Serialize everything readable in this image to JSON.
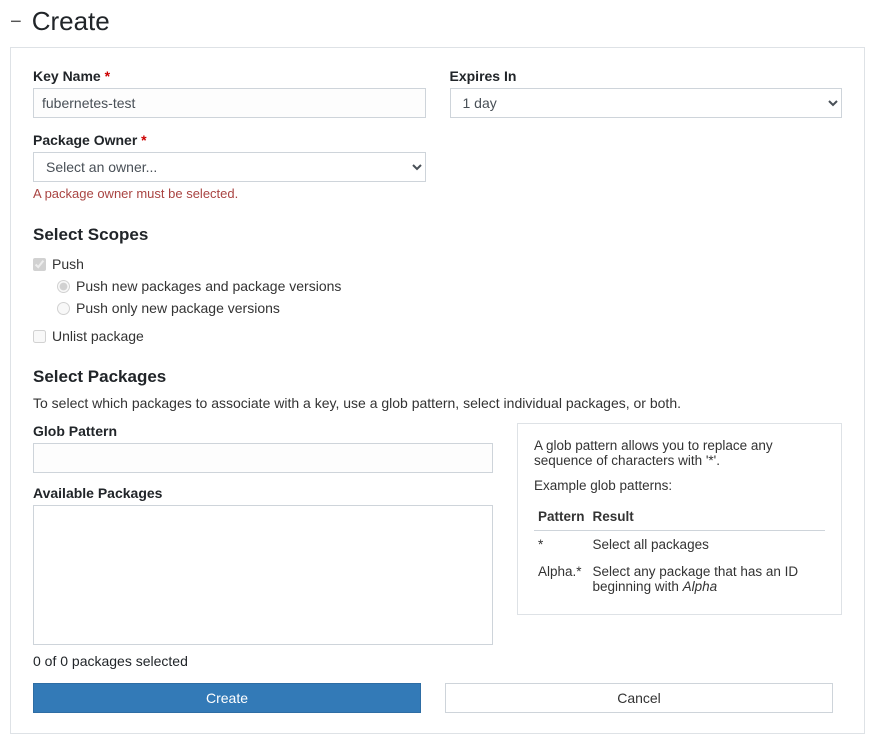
{
  "header": {
    "title": "Create"
  },
  "fields": {
    "key_name": {
      "label": "Key Name",
      "required_mark": "*",
      "value": "fubernetes-test"
    },
    "expires": {
      "label": "Expires In",
      "value": "1 day"
    },
    "owner": {
      "label": "Package Owner",
      "required_mark": "*",
      "placeholder": "Select an owner...",
      "error": "A package owner must be selected."
    }
  },
  "scopes": {
    "heading": "Select Scopes",
    "push": {
      "label": "Push"
    },
    "push_new_all": {
      "label": "Push new packages and package versions"
    },
    "push_versions": {
      "label": "Push only new package versions"
    },
    "unlist": {
      "label": "Unlist package"
    }
  },
  "packages": {
    "heading": "Select Packages",
    "desc": "To select which packages to associate with a key, use a glob pattern, select individual packages, or both.",
    "glob_label": "Glob Pattern",
    "avail_label": "Available Packages",
    "sel_count": "0 of 0 packages selected",
    "hint": {
      "p1": "A glob pattern allows you to replace any sequence of characters with '*'.",
      "p2": "Example glob patterns:",
      "th1": "Pattern",
      "th2": "Result",
      "r1p": "*",
      "r1r": "Select all packages",
      "r2p": "Alpha.*",
      "r2r_prefix": "Select any package that has an ID beginning with ",
      "r2r_em": "Alpha"
    }
  },
  "buttons": {
    "create": "Create",
    "cancel": "Cancel"
  }
}
